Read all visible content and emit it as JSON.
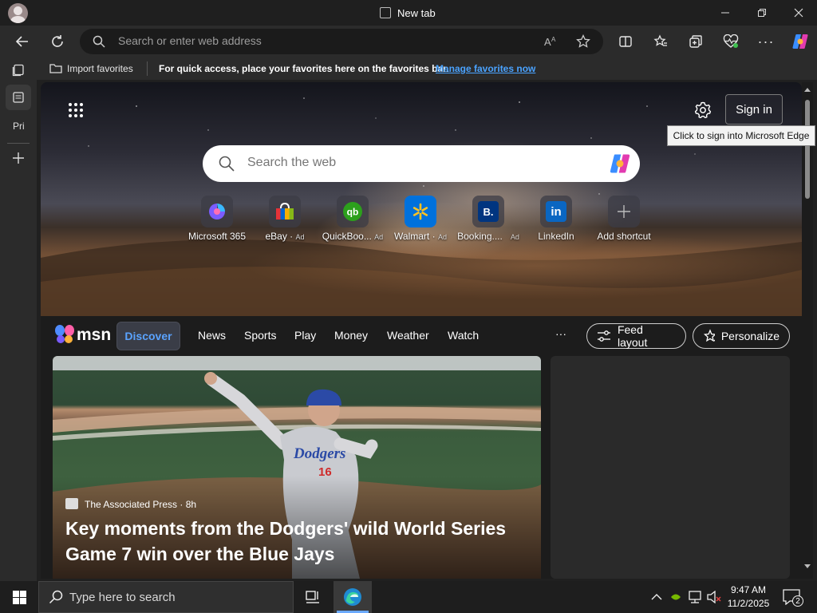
{
  "window": {
    "tab_title": "New tab"
  },
  "toolbar": {
    "address_placeholder": "Search or enter web address"
  },
  "favorites_bar": {
    "import_label": "Import favorites",
    "hint": "For quick access, place your favorites here on the favorites bar.",
    "manage_link": "Manage favorites now"
  },
  "sidebar": {
    "collapsed_label": "Pri"
  },
  "newtab": {
    "sign_in": "Sign in",
    "tooltip": "Click to sign into Microsoft Edge",
    "search_placeholder": "Search the web",
    "shortcuts": [
      {
        "label": "Microsoft 365",
        "ad": ""
      },
      {
        "label": "eBay",
        "ad": "Ad"
      },
      {
        "label": "QuickBoo...",
        "ad": "Ad"
      },
      {
        "label": "Walmart",
        "ad": "Ad"
      },
      {
        "label": "Booking....",
        "ad": "Ad"
      },
      {
        "label": "LinkedIn",
        "ad": ""
      },
      {
        "label": "Add shortcut",
        "ad": ""
      }
    ],
    "shortcut_letters": {
      "booking": "B.",
      "linkedin": "in",
      "quickbooks": "qb"
    }
  },
  "msn": {
    "logo": "msn",
    "nav": [
      "Discover",
      "News",
      "Sports",
      "Play",
      "Money",
      "Weather",
      "Watch"
    ],
    "more": "···",
    "feed_layout": "Feed layout",
    "personalize": "Personalize",
    "headline": {
      "source": "The Associated Press",
      "age": "· 8h",
      "title": "Key moments from the Dodgers' wild World Series Game 7 win over the Blue Jays"
    },
    "jersey_text": "Dodgers",
    "jersey_number": "16"
  },
  "taskbar": {
    "search_placeholder": "Type here to search",
    "time": "9:47 AM",
    "date": "11/2/2025",
    "notifications": "2"
  },
  "colors": {
    "accent": "#5aa3ff",
    "link": "#4aa3ff"
  }
}
